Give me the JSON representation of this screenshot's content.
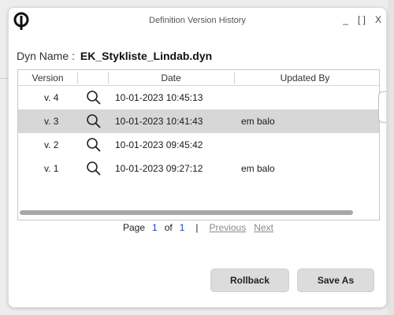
{
  "window": {
    "title": "Definition Version History",
    "minimize_label": "_",
    "maximize_label": "[ ]",
    "close_label": "X"
  },
  "dyn": {
    "label": "Dyn Name :",
    "value": "EK_Stykliste_Lindab.dyn"
  },
  "table": {
    "columns": [
      "Version",
      "Date",
      "Updated By"
    ],
    "rows": [
      {
        "version": "v. 4",
        "date": "10-01-2023 10:45:13",
        "updated_by": "",
        "selected": false
      },
      {
        "version": "v. 3",
        "date": "10-01-2023 10:41:43",
        "updated_by": "em balo",
        "selected": true
      },
      {
        "version": "v. 2",
        "date": "10-01-2023 09:45:42",
        "updated_by": "",
        "selected": false
      },
      {
        "version": "v. 1",
        "date": "10-01-2023 09:27:12",
        "updated_by": "em balo",
        "selected": false
      }
    ],
    "row_icon": "search-icon"
  },
  "pager": {
    "page_label": "Page",
    "current": "1",
    "of_label": "of",
    "total": "1",
    "separator": "|",
    "previous_label": "Previous",
    "next_label": "Next"
  },
  "actions": {
    "rollback_label": "Rollback",
    "save_as_label": "Save As"
  },
  "colors": {
    "selected_row": "#d7d7d7",
    "page_number": "#1f3fbf",
    "disabled_link": "#8a8a8a",
    "button_bg": "#dcdcdc"
  }
}
